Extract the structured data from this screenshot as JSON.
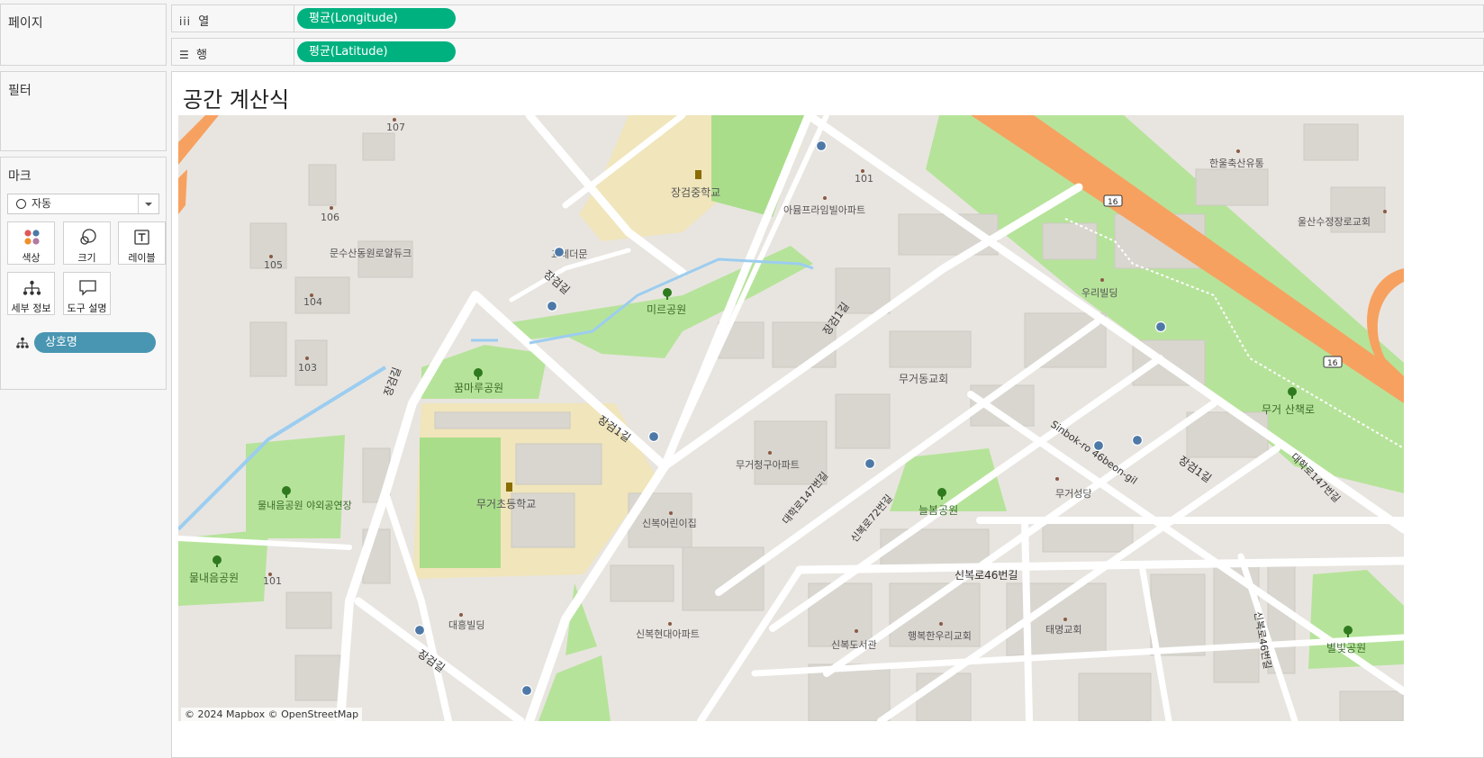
{
  "side": {
    "pages_title": "페이지",
    "filters_title": "필터",
    "marks_title": "마크",
    "mark_type": "자동",
    "buttons": {
      "color": "색상",
      "size": "크기",
      "label": "레이블",
      "detail": "세부 정보",
      "tooltip": "도구 설명"
    },
    "detail_pill": "상호명"
  },
  "shelves": {
    "columns_label": "열",
    "columns_pill": "평균(Longitude)",
    "rows_label": "행",
    "rows_pill": "평균(Latitude)"
  },
  "view": {
    "title": "공간 계산식",
    "attribution": "© 2024 Mapbox © OpenStreetMap"
  },
  "map": {
    "labels": {
      "jg_school": "장검중학교",
      "adam": "아뮴프라임빌아파트",
      "b101a": "101",
      "b107": "107",
      "b106": "106",
      "b105": "105",
      "b104": "104",
      "b103": "103",
      "b101b": "101",
      "munsu": "문수산동원로얄듀크",
      "gyodm": "교레더문",
      "jg_gil1": "장검길",
      "mire": "미르공원",
      "kkum": "꿈마루공원",
      "jg1_a": "장검1길",
      "jg1_b": "장검1길",
      "jg1_c": "장검1길",
      "mg_es": "무거초등학교",
      "mulnae_out": "물내음공원 야외공연장",
      "mulnae": "물내음공원",
      "daeheung": "대흥빌딩",
      "jg_gil2": "장검길",
      "jg_gil3": "장검길",
      "mugeo_ch": "무거동교회",
      "mugeo_apt": "무거청구아파트",
      "dh147a": "대학로147번길",
      "dh147b": "대학로147번길",
      "sb72": "신복로72번길",
      "sinbok_kg": "신복어린이집",
      "neulbom": "늘봄공원",
      "sb46": "신복로46번길",
      "sinbok_hd": "신복현대아파트",
      "sinbok_lib": "신복도서관",
      "hbhw": "행복한우리교회",
      "taemyeong": "태명교회",
      "sinbok46_2": "신복로46번길",
      "byeolbit": "별빛공원",
      "sinbok46beon": "Sinbok-ro 46beon-gil",
      "mugeo_sc": "무거성당",
      "uri": "우리빌딩",
      "mugeo_walk": "무거 산책로",
      "hanul": "한울축산유통",
      "ulsan": "울산수정장로교회",
      "route16a": "16",
      "route16b": "16"
    },
    "point_color": "#4e79a7",
    "point_count": 15
  }
}
